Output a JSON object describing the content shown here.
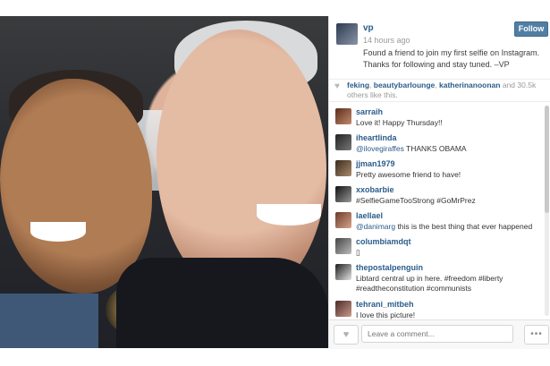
{
  "post": {
    "username": "vp",
    "time": "14 hours ago",
    "caption": "Found a friend to join my first selfie on Instagram. Thanks for following and stay tuned. –VP",
    "follow_label": "Follow"
  },
  "likes": {
    "names": [
      "feking",
      "beautybarlounge",
      "katherinanoonan"
    ],
    "and": "and",
    "count": "30.5k",
    "suffix": "others like this."
  },
  "comments": [
    {
      "user": "sarraih",
      "mention": "",
      "text": "Love it! Happy Thursday!!"
    },
    {
      "user": "iheartlinda",
      "mention": "@ilovegiraffes",
      "text": " THANKS OBAMA"
    },
    {
      "user": "jjman1979",
      "mention": "",
      "text": "Pretty awesome friend to have!"
    },
    {
      "user": "xxobarbie",
      "mention": "",
      "text": "#SelfieGameTooStrong #GoMrPrez"
    },
    {
      "user": "laellael",
      "mention": "@danimarg",
      "text": " this is the best thing that ever happened"
    },
    {
      "user": "columbiamdqt",
      "mention": "",
      "text": "▯"
    },
    {
      "user": "thepostalpenguin",
      "mention": "",
      "text": "Libtard central up in here. #freedom #liberty #readtheconstitution #communists"
    },
    {
      "user": "tehrani_mitbeh",
      "mention": "",
      "text": "I love this picture!"
    }
  ],
  "footer": {
    "comment_placeholder": "Leave a comment...",
    "more_label": "•••",
    "like_icon": "heart-icon"
  }
}
